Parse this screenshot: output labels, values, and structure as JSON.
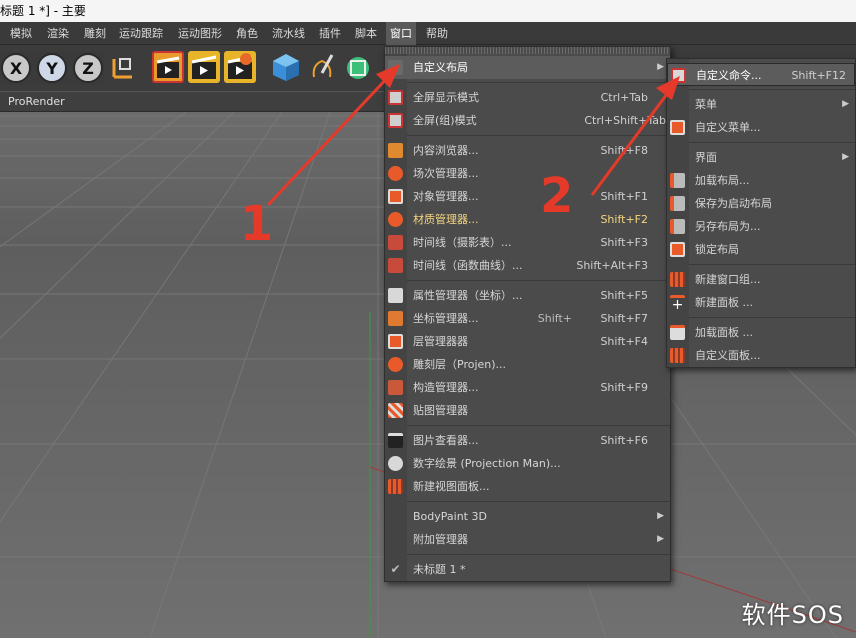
{
  "window": {
    "title": "标题 1 *] - 主要"
  },
  "menubar": [
    {
      "label": "模拟"
    },
    {
      "label": "渲染"
    },
    {
      "label": "雕刻"
    },
    {
      "label": "运动跟踪"
    },
    {
      "label": "运动图形"
    },
    {
      "label": "角色"
    },
    {
      "label": "流水线"
    },
    {
      "label": "插件"
    },
    {
      "label": "脚本"
    },
    {
      "label": "窗口",
      "active": true
    },
    {
      "label": "帮助"
    }
  ],
  "toolbar": {
    "axes": [
      "X",
      "Y",
      "Z"
    ]
  },
  "viewport_tab": {
    "label": "ProRender"
  },
  "window_menu": {
    "items": [
      {
        "label": "自定义布局",
        "submenu": true,
        "highlighted": true
      },
      {
        "label": "全屏显示模式",
        "shortcut": "Ctrl+Tab",
        "icon": "fullscreen-icon"
      },
      {
        "label": "全屏(组)模式",
        "shortcut": "Ctrl+Shift+Tab",
        "icon": "fullscreen-group-icon"
      },
      {
        "label": "内容浏览器...",
        "shortcut": "Shift+F8",
        "icon": "content-browser-icon"
      },
      {
        "label": "场次管理器...",
        "shortcut": "",
        "icon": "take-manager-icon"
      },
      {
        "label": "对象管理器...",
        "shortcut": "Shift+F1",
        "icon": "object-manager-icon"
      },
      {
        "label": "材质管理器...",
        "shortcut": "Shift+F2",
        "icon": "material-manager-icon",
        "orange": true
      },
      {
        "label": "时间线（摄影表）...",
        "shortcut": "Shift+F3",
        "icon": "timeline-dopesheet-icon"
      },
      {
        "label": "时间线（函数曲线）...",
        "shortcut": "Shift+Alt+F3",
        "icon": "timeline-fcurve-icon"
      },
      {
        "label": "属性管理器（坐标）...",
        "shortcut": "Shift+F5",
        "icon": "attribute-manager-icon"
      },
      {
        "label": "坐标管理器...",
        "shortcut": "Shift+F7",
        "icon": "coordinate-manager-icon",
        "ghost": "Shift+"
      },
      {
        "label": "层管理器器",
        "shortcut": "Shift+F4",
        "icon": "layer-manager-icon"
      },
      {
        "label": "雕刻层（Projen)...",
        "shortcut": "",
        "icon": "sculpt-layer-icon"
      },
      {
        "label": "构造管理器...",
        "shortcut": "Shift+F9",
        "icon": "structure-manager-icon"
      },
      {
        "label": "贴图管理器",
        "shortcut": "",
        "icon": "texture-manager-icon"
      },
      {
        "label": "图片查看器...",
        "shortcut": "Shift+F6",
        "icon": "picture-viewer-icon"
      },
      {
        "label": "数字绘景 (Projection Man)...",
        "shortcut": "",
        "icon": "projection-man-icon"
      },
      {
        "label": "新建视图面板...",
        "shortcut": "",
        "icon": "new-viewport-icon"
      },
      {
        "label": "BodyPaint 3D",
        "submenu": true
      },
      {
        "label": "附加管理器",
        "submenu": true
      },
      {
        "label": "未标题 1 *",
        "checked": true
      }
    ]
  },
  "layout_submenu": {
    "items": [
      {
        "label": "自定义命令...",
        "shortcut": "Shift+F12",
        "highlighted": true,
        "icon": "customize-commands-icon"
      },
      {
        "label": "菜单",
        "submenu": true
      },
      {
        "label": "自定义菜单...",
        "icon": "customize-menu-icon"
      },
      {
        "label": "界面",
        "submenu": true
      },
      {
        "label": "加载布局...",
        "icon": "load-layout-icon"
      },
      {
        "label": "保存为启动布局",
        "icon": "save-startup-layout-icon"
      },
      {
        "label": "另存布局为...",
        "icon": "save-layout-as-icon"
      },
      {
        "label": "锁定布局",
        "icon": "lock-layout-icon"
      },
      {
        "label": "新建窗口组...",
        "icon": "new-window-group-icon"
      },
      {
        "label": "新建面板 ...",
        "icon": "new-palette-icon"
      },
      {
        "label": "加载面板 ...",
        "icon": "load-palette-icon"
      },
      {
        "label": "自定义面板...",
        "icon": "customize-palettes-icon"
      }
    ]
  },
  "annotations": {
    "one": "1",
    "two": "2"
  },
  "watermark": {
    "text": "软件SOS"
  },
  "colors": {
    "arrow": "#e53a2a",
    "menu_bg": "#4b4b4b",
    "highlight": "#5c5c5c",
    "material_text": "#f5d680"
  }
}
